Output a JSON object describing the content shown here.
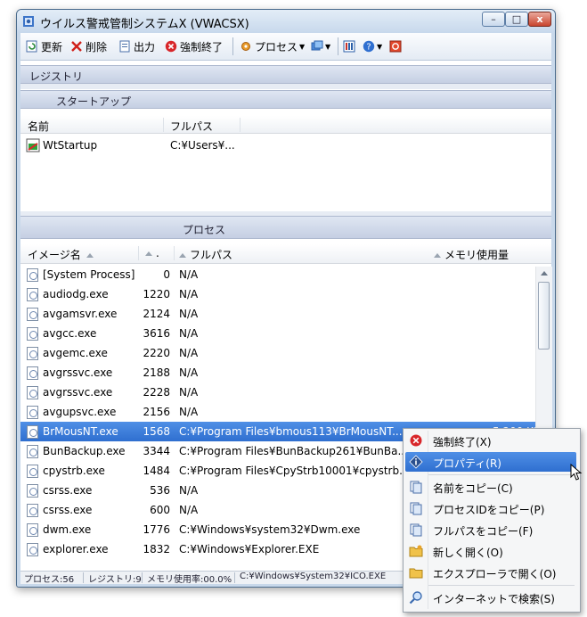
{
  "window": {
    "title": "ウイルス警戒管制システムX (VWACSX)"
  },
  "caption_buttons": {
    "minimize": "–",
    "maximize": "□",
    "close": "x"
  },
  "toolbar": {
    "refresh": "更新",
    "delete": "削除",
    "output": "出力",
    "kill": "強制終了",
    "process": "プロセス"
  },
  "sections": {
    "registry": "レジストリ",
    "startup": "スタートアップ",
    "process": "プロセス"
  },
  "startup_table": {
    "columns": [
      "名前",
      "フルパス"
    ],
    "rows": [
      {
        "name": "WtStartup",
        "path": "C:¥Users¥..."
      }
    ]
  },
  "process_table": {
    "columns": [
      "イメージ名",
      ".",
      "フルパス",
      "メモリ使用量"
    ],
    "rows": [
      {
        "name": "[System Process]",
        "pid": "0",
        "path": "N/A",
        "mem": ""
      },
      {
        "name": "audiodg.exe",
        "pid": "1220",
        "path": "N/A",
        "mem": ""
      },
      {
        "name": "avgamsvr.exe",
        "pid": "2124",
        "path": "N/A",
        "mem": ""
      },
      {
        "name": "avgcc.exe",
        "pid": "3616",
        "path": "N/A",
        "mem": ""
      },
      {
        "name": "avgemc.exe",
        "pid": "2220",
        "path": "N/A",
        "mem": ""
      },
      {
        "name": "avgrssvc.exe",
        "pid": "2188",
        "path": "N/A",
        "mem": ""
      },
      {
        "name": "avgrssvc.exe",
        "pid": "2228",
        "path": "N/A",
        "mem": ""
      },
      {
        "name": "avgupsvc.exe",
        "pid": "2156",
        "path": "N/A",
        "mem": ""
      },
      {
        "name": "BrMousNT.exe",
        "pid": "1568",
        "path": "C:¥Program Files¥bmous113¥BrMousNT....",
        "mem": "5,200 KB"
      },
      {
        "name": "BunBackup.exe",
        "pid": "3344",
        "path": "C:¥Program Files¥BunBackup261¥BunBa...",
        "mem": ""
      },
      {
        "name": "cpystrb.exe",
        "pid": "1484",
        "path": "C:¥Program Files¥CpyStrb10001¥cpystrb....",
        "mem": ""
      },
      {
        "name": "csrss.exe",
        "pid": "536",
        "path": "N/A",
        "mem": ""
      },
      {
        "name": "csrss.exe",
        "pid": "600",
        "path": "N/A",
        "mem": ""
      },
      {
        "name": "dwm.exe",
        "pid": "1776",
        "path": "C:¥Windows¥system32¥Dwm.exe",
        "mem": ""
      },
      {
        "name": "explorer.exe",
        "pid": "1832",
        "path": "C:¥Windows¥Explorer.EXE",
        "mem": ""
      }
    ]
  },
  "statusbar": {
    "process_count": "プロセス:56",
    "registry_count": "レジストリ:9",
    "memory": "メモリ使用率:00.0%",
    "path": "C:¥Windows¥System32¥ICO.EXE"
  },
  "context_menu": {
    "kill": "強制終了(X)",
    "properties": "プロパティ(R)",
    "copy_name": "名前をコピー(C)",
    "copy_pid": "プロセスIDをコピー(P)",
    "copy_path": "フルパスをコピー(F)",
    "open": "新しく開く(O)",
    "open_explorer": "エクスプローラで開く(O)",
    "search_internet": "インターネットで検索(S)"
  },
  "colors": {
    "selection": "#3a7ad8",
    "section_band": "#cdd6e8",
    "frame": "#c8d8ea"
  }
}
